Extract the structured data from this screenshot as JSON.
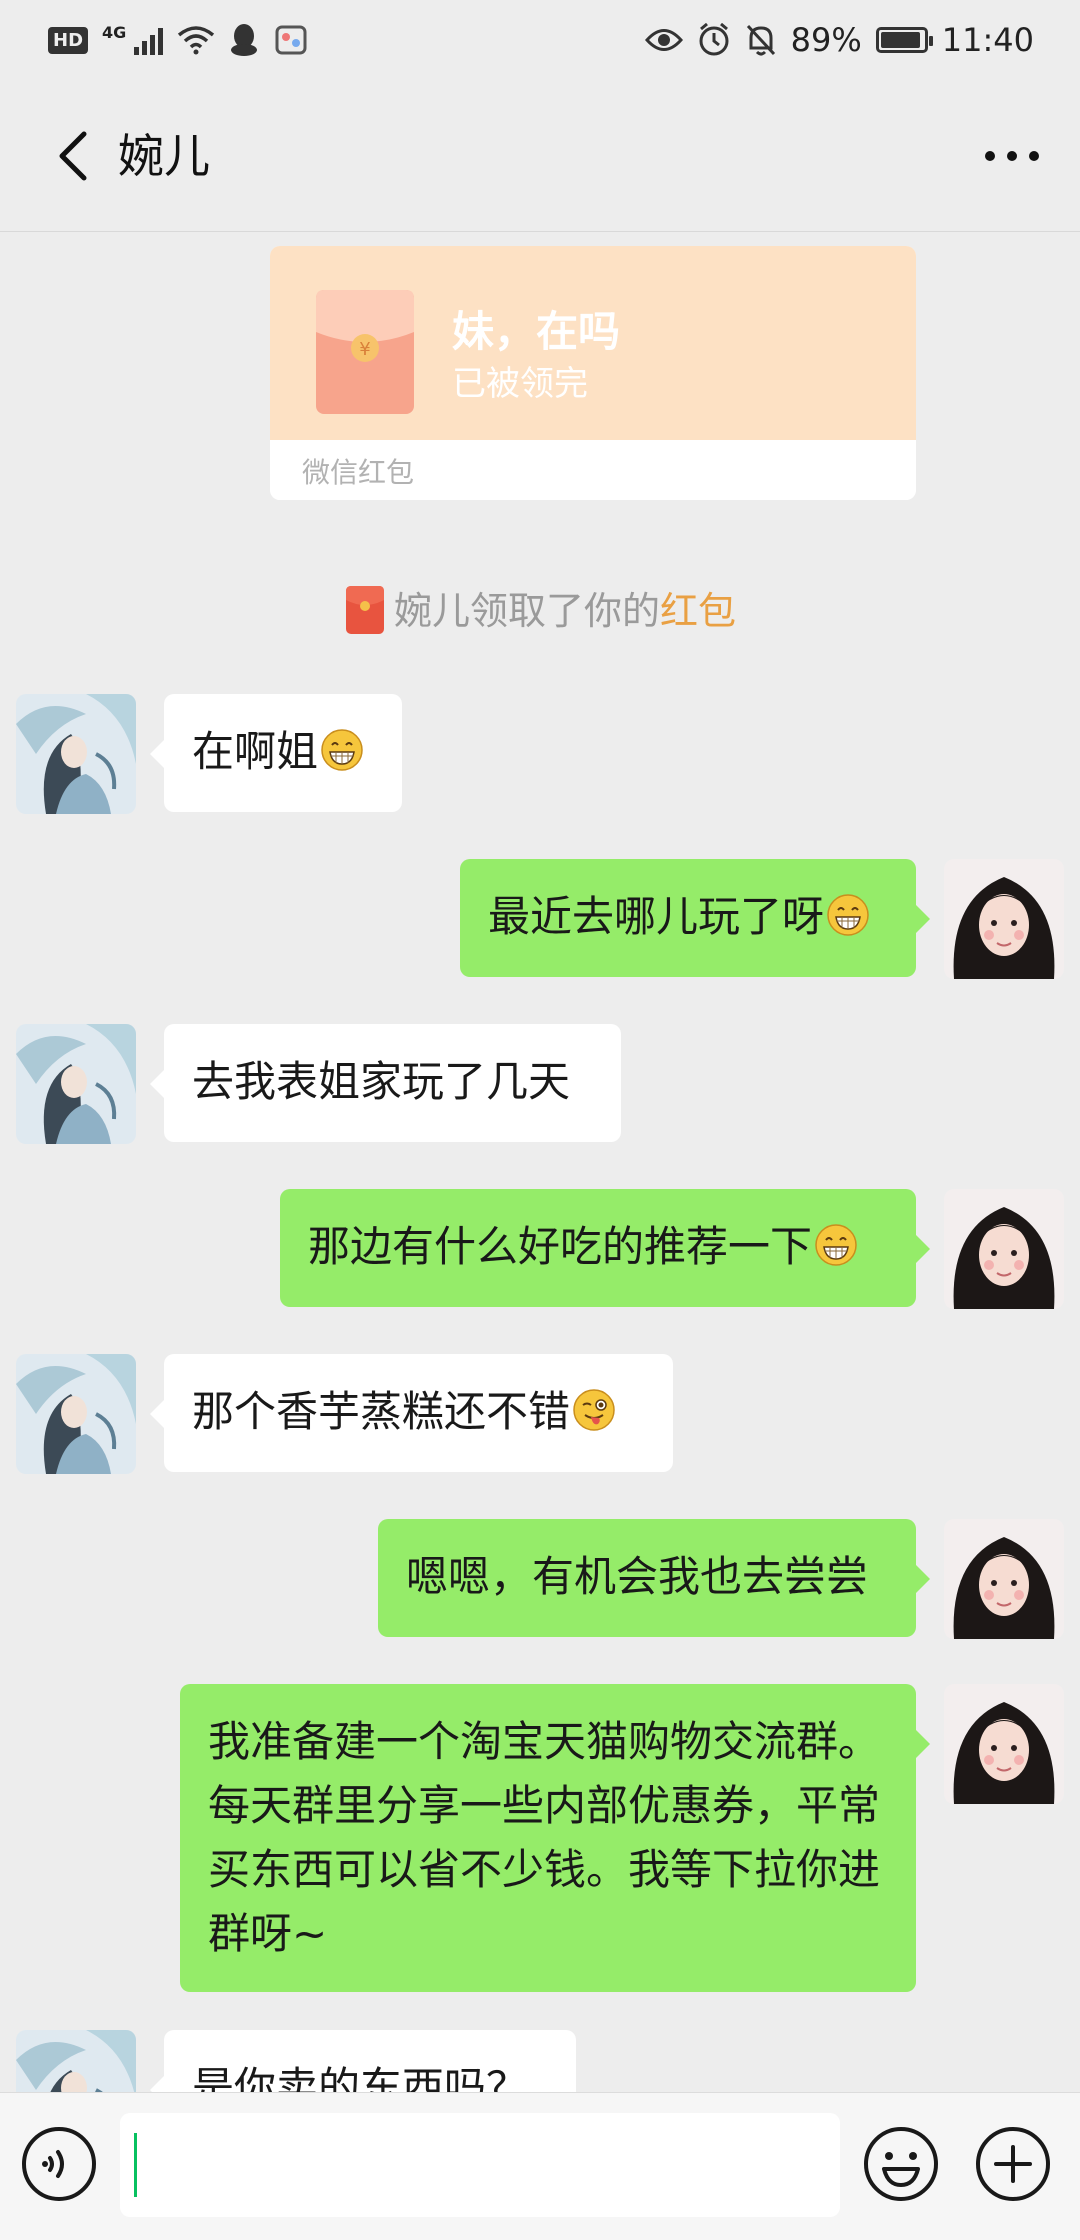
{
  "status_bar": {
    "hd": "HD",
    "network": "4G",
    "battery": "89%",
    "battery_level": 0.89,
    "time": "11:40"
  },
  "header": {
    "title": "婉儿",
    "back_icon": "chevron-left-icon",
    "more_icon": "more-dots-icon"
  },
  "red_packet": {
    "greeting": "妹，在吗",
    "status": "已被领完",
    "label": "微信红包",
    "color": "#fde1c4"
  },
  "system_message": {
    "text": "婉儿领取了你的",
    "link": "红包"
  },
  "messages": [
    {
      "from": "other",
      "text": "在啊姐",
      "emoji": "grin"
    },
    {
      "from": "me",
      "text": "最近去哪儿玩了呀",
      "emoji": "grin"
    },
    {
      "from": "other",
      "text": "去我表姐家玩了几天",
      "emoji": ""
    },
    {
      "from": "me",
      "text": "那边有什么好吃的推荐一下",
      "emoji": "grin"
    },
    {
      "from": "other",
      "text": "那个香芋蒸糕还不错",
      "emoji": "wink-tongue"
    },
    {
      "from": "me",
      "text": "嗯嗯，有机会我也去尝尝",
      "emoji": ""
    },
    {
      "from": "me",
      "text": "我准备建一个淘宝天猫购物交流群。每天群里分享一些内部优惠券，平常买东西可以省不少钱。我等下拉你进群呀~",
      "emoji": ""
    },
    {
      "from": "other",
      "text": "是你卖的东西吗？",
      "emoji": ""
    }
  ],
  "colors": {
    "background": "#ededed",
    "bubble_out": "#95ec69",
    "bubble_in": "#ffffff",
    "link": "#e9a043"
  },
  "input_bar": {
    "voice_icon": "voice-icon",
    "emoji_icon": "emoji-icon",
    "plus_icon": "plus-icon"
  }
}
